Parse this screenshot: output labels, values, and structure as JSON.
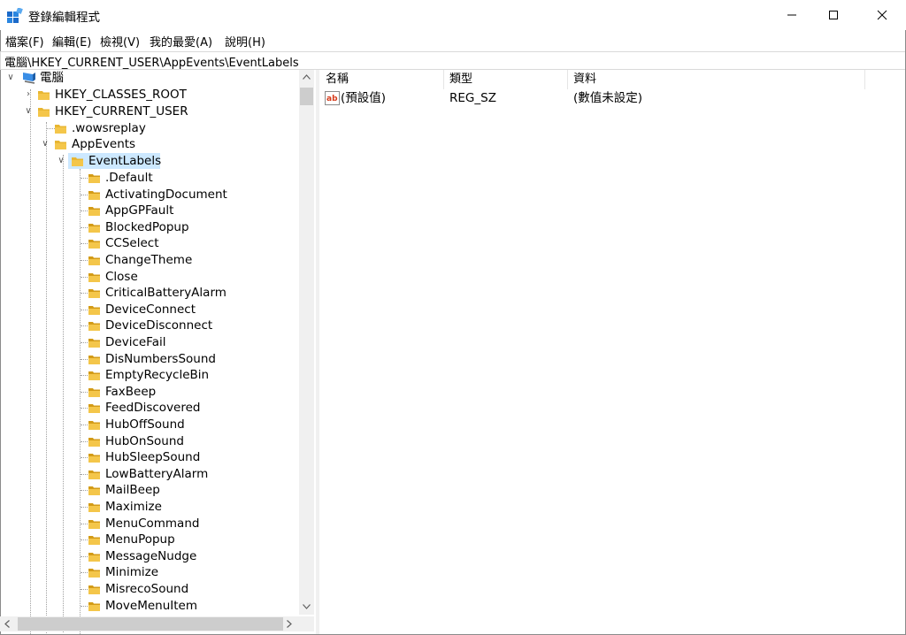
{
  "window": {
    "title": "登錄編輯程式"
  },
  "menu": [
    "檔案(F)",
    "編輯(E)",
    "檢視(V)",
    "我的最愛(A)",
    "說明(H)"
  ],
  "address": "電腦\\HKEY_CURRENT_USER\\AppEvents\\EventLabels",
  "tree": {
    "root": "電腦",
    "classes_root": "HKEY_CLASSES_ROOT",
    "current_user": "HKEY_CURRENT_USER",
    "wowsreplay": ".wowsreplay",
    "appevents": "AppEvents",
    "eventlabels": "EventLabels",
    "children": [
      ".Default",
      "ActivatingDocument",
      "AppGPFault",
      "BlockedPopup",
      "CCSelect",
      "ChangeTheme",
      "Close",
      "CriticalBatteryAlarm",
      "DeviceConnect",
      "DeviceDisconnect",
      "DeviceFail",
      "DisNumbersSound",
      "EmptyRecycleBin",
      "FaxBeep",
      "FeedDiscovered",
      "HubOffSound",
      "HubOnSound",
      "HubSleepSound",
      "LowBatteryAlarm",
      "MailBeep",
      "Maximize",
      "MenuCommand",
      "MenuPopup",
      "MessageNudge",
      "Minimize",
      "MisrecoSound",
      "MoveMenuItem"
    ]
  },
  "columns": {
    "name": "名稱",
    "type": "類型",
    "data": "資料"
  },
  "rows": [
    {
      "name": "(預設值)",
      "type": "REG_SZ",
      "data": "(數值未設定)"
    }
  ],
  "colors": {
    "selection": "#cce8ff",
    "folder": "#e8b632",
    "folder_dark": "#d39b17"
  }
}
